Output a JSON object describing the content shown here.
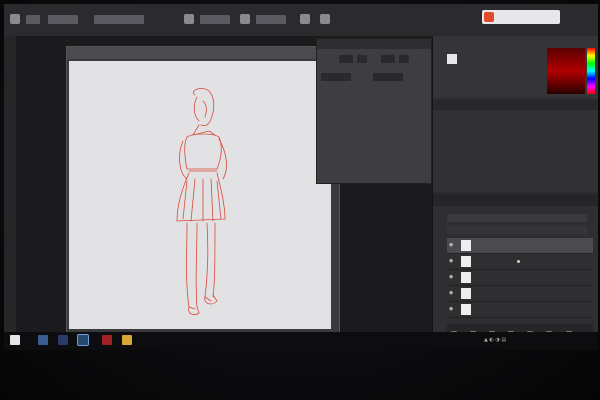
{
  "brand": {
    "label": ""
  },
  "document": {
    "tab_title": "",
    "close_glyph": "×"
  },
  "float_panel": {
    "title": "",
    "fields": [
      {
        "label": "",
        "value": ""
      },
      {
        "label": "",
        "value": ""
      }
    ]
  },
  "history": {
    "items": [
      {
        "label": "",
        "selected": false
      },
      {
        "label": "",
        "selected": false
      },
      {
        "label": "",
        "selected": true
      }
    ]
  },
  "properties": {
    "title": ""
  },
  "layers": {
    "tab_label": "",
    "rows": [
      {
        "name": "",
        "selected": true
      },
      {
        "name": "",
        "selected": false
      },
      {
        "name": "",
        "selected": false
      },
      {
        "name": "",
        "selected": false
      },
      {
        "name": "",
        "selected": false
      }
    ]
  },
  "taskbar": {
    "clock": {
      "time": "",
      "date": ""
    }
  },
  "colors": {
    "sketch_stroke": "#d94a3a",
    "canvas_bg": "#e2e2e4",
    "brand_logo": "#e24a2c"
  },
  "icons": {
    "tool": "brush-icon",
    "start": "windows-start-icon",
    "eye": "eye-icon"
  }
}
